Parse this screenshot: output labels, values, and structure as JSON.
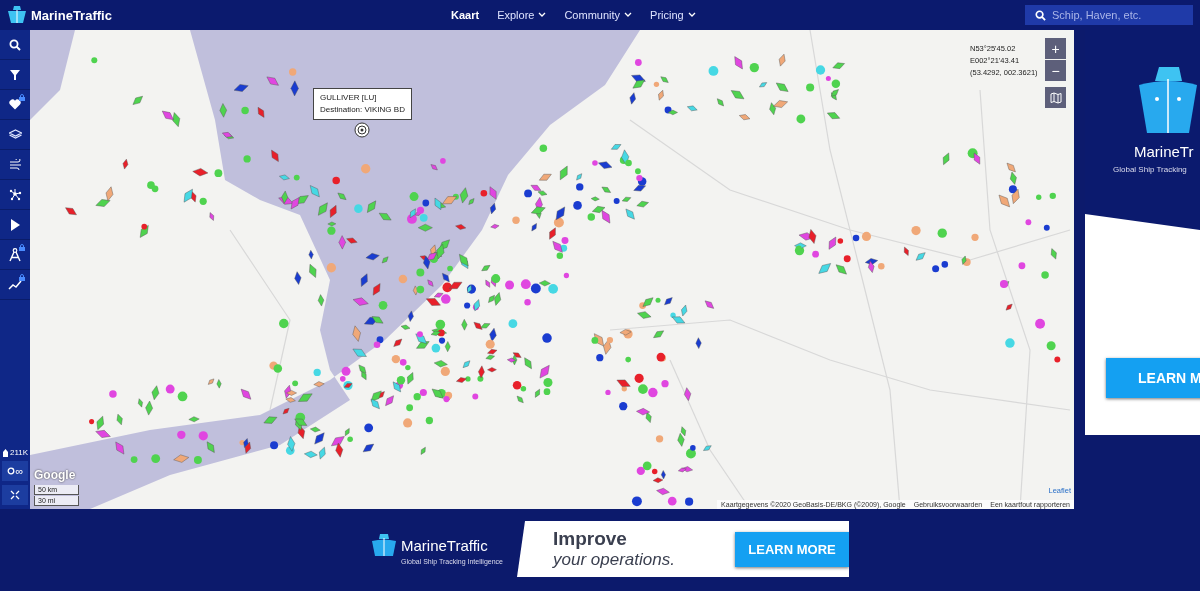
{
  "header": {
    "logo": "MarineTraffic",
    "nav": [
      {
        "label": "Kaart",
        "selected": true,
        "dropdown": false
      },
      {
        "label": "Explore",
        "selected": false,
        "dropdown": true
      },
      {
        "label": "Community",
        "selected": false,
        "dropdown": true
      },
      {
        "label": "Pricing",
        "selected": false,
        "dropdown": true
      }
    ],
    "search": {
      "placeholder": "Schip, Haven, etc."
    }
  },
  "sidebar": {
    "tools": [
      {
        "kind": "search",
        "locked": false
      },
      {
        "kind": "filter",
        "locked": false
      },
      {
        "kind": "favorites",
        "locked": true
      },
      {
        "kind": "layers",
        "locked": false
      },
      {
        "kind": "wind",
        "locked": false
      },
      {
        "kind": "network",
        "locked": false
      },
      {
        "kind": "play",
        "locked": false
      },
      {
        "kind": "compass",
        "locked": true
      },
      {
        "kind": "chart",
        "locked": true
      }
    ],
    "vessel_count": "211K",
    "toggle": "∞"
  },
  "map": {
    "popup": {
      "title": "GULLIVER [LU]",
      "destination": "Destination: VIKING BD"
    },
    "coordinates": [
      "N53°25'45.02",
      "E002°21'43.41",
      "(53.4292, 002.3621)"
    ],
    "zoom": [
      "+",
      "−"
    ],
    "logo": "Google",
    "scale": [
      "50 km",
      "30 mi"
    ],
    "leaflet": "Leaflet",
    "attribution": [
      "Kaartgegevens ©2020 GeoBasis-DE/BKG (©2009), Google",
      "Gebruiksvoorwaarden",
      "Een kaartfout rapporteren"
    ]
  },
  "ads": {
    "side": {
      "brand": "MarineTr",
      "tagline": "Global Ship Tracking",
      "button": "LEARN M"
    },
    "bottom": {
      "brand": "MarineTraffic",
      "tagline": "Global Ship Tracking Intelligence",
      "headline": "Improve",
      "subline": "your operations.",
      "button": "LEARN MORE"
    }
  }
}
